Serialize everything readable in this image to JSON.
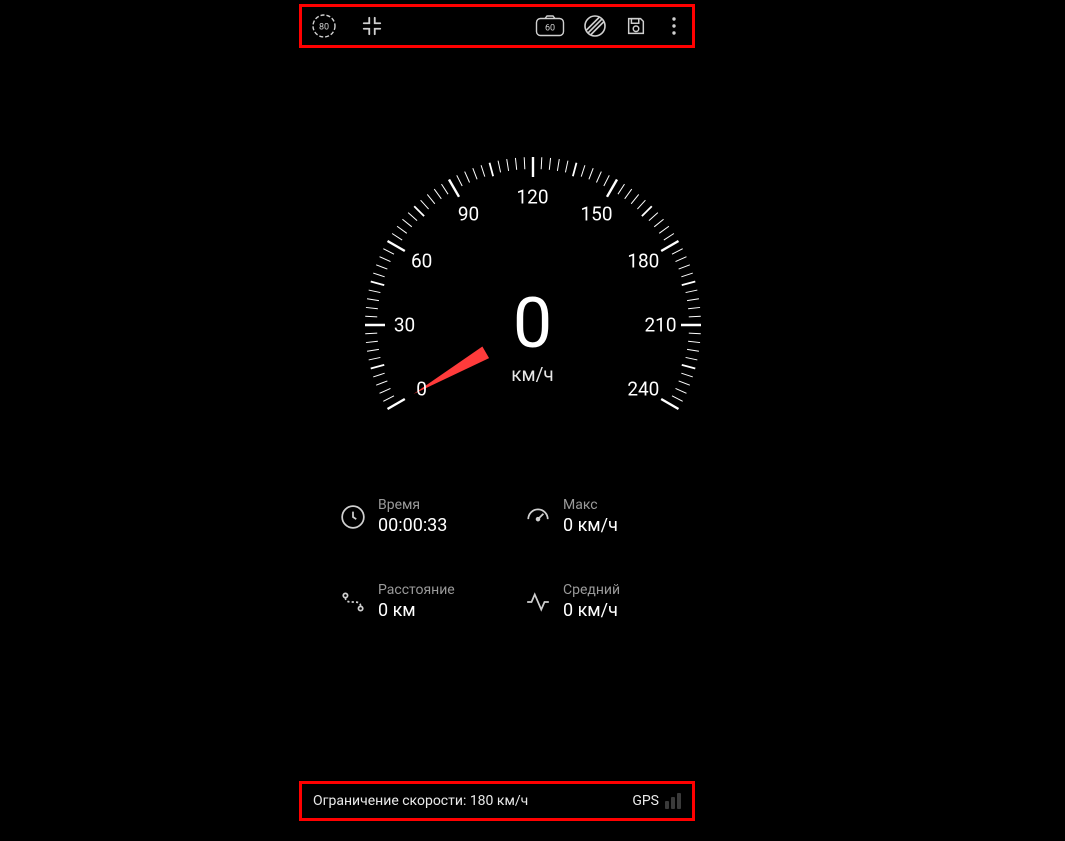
{
  "toolbar": {
    "speed_limit_icon_value": "80",
    "camera_badge_value": "60"
  },
  "gauge": {
    "value": "0",
    "unit": "км/ч",
    "min": 0,
    "max": 240,
    "ticks": [
      0,
      30,
      60,
      90,
      120,
      150,
      180,
      210,
      240
    ]
  },
  "stats": {
    "time": {
      "label": "Время",
      "value": "00:00:33"
    },
    "max": {
      "label": "Макс",
      "value": "0 км/ч"
    },
    "distance": {
      "label": "Расстояние",
      "value": "0 км"
    },
    "avg": {
      "label": "Средний",
      "value": "0 км/ч"
    }
  },
  "bottom": {
    "limit_text": "Ограничение скорости: 180 км/ч",
    "gps_label": "GPS"
  }
}
